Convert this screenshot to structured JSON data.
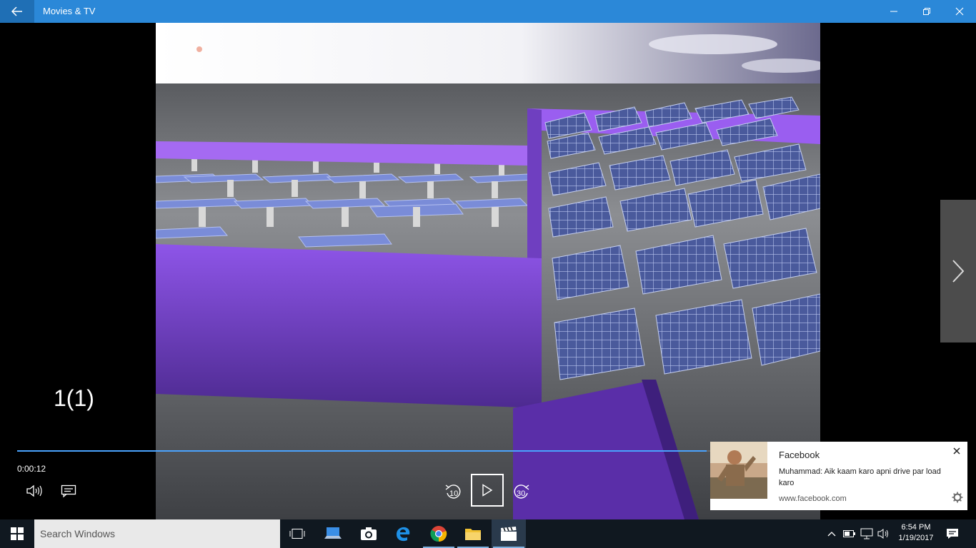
{
  "window": {
    "title": "Movies & TV"
  },
  "video": {
    "title": "1(1)",
    "current_time": "0:00:12",
    "progress_fraction": 0.732,
    "skip_back_label": "10",
    "skip_forward_label": "30"
  },
  "notification": {
    "app": "Facebook",
    "message": "Muhammad: Aik kaam karo apni drive par load karo",
    "source": "www.facebook.com"
  },
  "taskbar": {
    "search_placeholder": "Search Windows",
    "time": "6:54 PM",
    "date": "1/19/2017"
  },
  "colors": {
    "titlebar": "#2b88d8",
    "accent": "#4aa3ff",
    "taskbar": "#101820"
  }
}
